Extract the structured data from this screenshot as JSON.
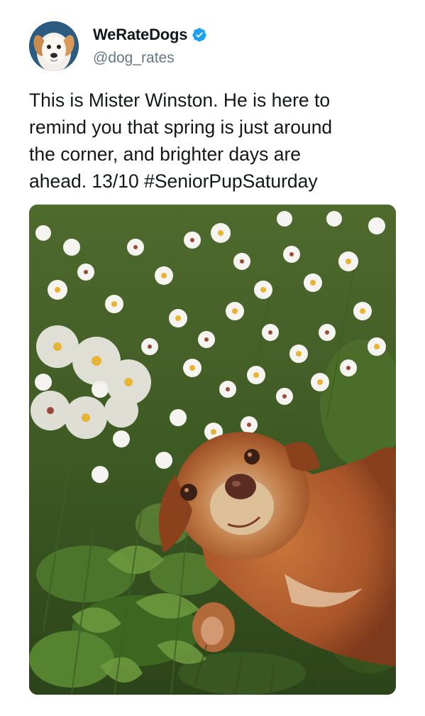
{
  "tweet": {
    "author": {
      "display_name": "WeRateDogs",
      "handle": "@dog_rates",
      "verified": true,
      "avatar_icon": "dog-avatar-icon",
      "verified_icon": "verified-badge-icon"
    },
    "text": "This is Mister Winston. He is here to\nremind you that spring is just around\nthe corner, and brighter days are\nahead. 13/10 #SeniorPupSaturday",
    "media": {
      "type": "photo",
      "icon": "dog-among-flowers-photo"
    }
  },
  "colors": {
    "verified_blue": "#1da1f2",
    "text_primary": "#14171a",
    "text_secondary": "#657786"
  }
}
